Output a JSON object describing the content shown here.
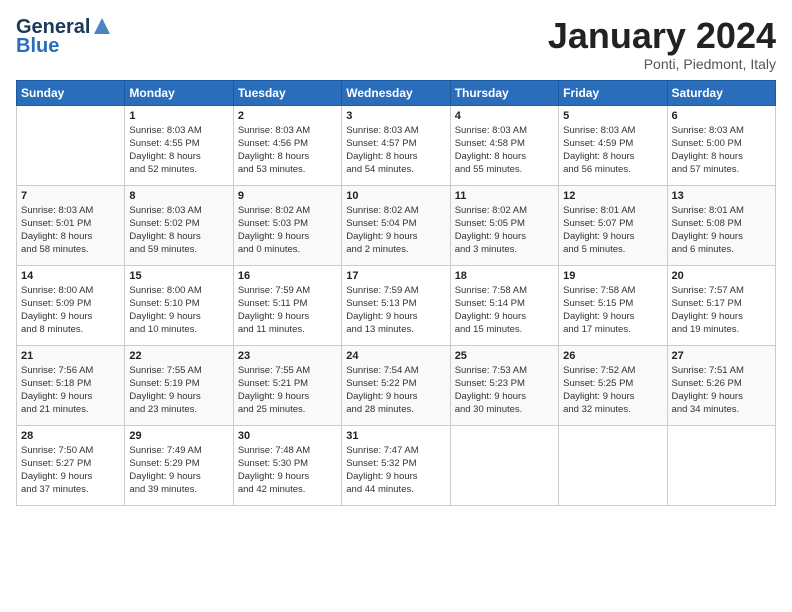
{
  "logo": {
    "line1": "General",
    "line2": "Blue"
  },
  "title": "January 2024",
  "subtitle": "Ponti, Piedmont, Italy",
  "days_header": [
    "Sunday",
    "Monday",
    "Tuesday",
    "Wednesday",
    "Thursday",
    "Friday",
    "Saturday"
  ],
  "weeks": [
    [
      {
        "day": "",
        "info": ""
      },
      {
        "day": "1",
        "info": "Sunrise: 8:03 AM\nSunset: 4:55 PM\nDaylight: 8 hours\nand 52 minutes."
      },
      {
        "day": "2",
        "info": "Sunrise: 8:03 AM\nSunset: 4:56 PM\nDaylight: 8 hours\nand 53 minutes."
      },
      {
        "day": "3",
        "info": "Sunrise: 8:03 AM\nSunset: 4:57 PM\nDaylight: 8 hours\nand 54 minutes."
      },
      {
        "day": "4",
        "info": "Sunrise: 8:03 AM\nSunset: 4:58 PM\nDaylight: 8 hours\nand 55 minutes."
      },
      {
        "day": "5",
        "info": "Sunrise: 8:03 AM\nSunset: 4:59 PM\nDaylight: 8 hours\nand 56 minutes."
      },
      {
        "day": "6",
        "info": "Sunrise: 8:03 AM\nSunset: 5:00 PM\nDaylight: 8 hours\nand 57 minutes."
      }
    ],
    [
      {
        "day": "7",
        "info": "Sunrise: 8:03 AM\nSunset: 5:01 PM\nDaylight: 8 hours\nand 58 minutes."
      },
      {
        "day": "8",
        "info": "Sunrise: 8:03 AM\nSunset: 5:02 PM\nDaylight: 8 hours\nand 59 minutes."
      },
      {
        "day": "9",
        "info": "Sunrise: 8:02 AM\nSunset: 5:03 PM\nDaylight: 9 hours\nand 0 minutes."
      },
      {
        "day": "10",
        "info": "Sunrise: 8:02 AM\nSunset: 5:04 PM\nDaylight: 9 hours\nand 2 minutes."
      },
      {
        "day": "11",
        "info": "Sunrise: 8:02 AM\nSunset: 5:05 PM\nDaylight: 9 hours\nand 3 minutes."
      },
      {
        "day": "12",
        "info": "Sunrise: 8:01 AM\nSunset: 5:07 PM\nDaylight: 9 hours\nand 5 minutes."
      },
      {
        "day": "13",
        "info": "Sunrise: 8:01 AM\nSunset: 5:08 PM\nDaylight: 9 hours\nand 6 minutes."
      }
    ],
    [
      {
        "day": "14",
        "info": "Sunrise: 8:00 AM\nSunset: 5:09 PM\nDaylight: 9 hours\nand 8 minutes."
      },
      {
        "day": "15",
        "info": "Sunrise: 8:00 AM\nSunset: 5:10 PM\nDaylight: 9 hours\nand 10 minutes."
      },
      {
        "day": "16",
        "info": "Sunrise: 7:59 AM\nSunset: 5:11 PM\nDaylight: 9 hours\nand 11 minutes."
      },
      {
        "day": "17",
        "info": "Sunrise: 7:59 AM\nSunset: 5:13 PM\nDaylight: 9 hours\nand 13 minutes."
      },
      {
        "day": "18",
        "info": "Sunrise: 7:58 AM\nSunset: 5:14 PM\nDaylight: 9 hours\nand 15 minutes."
      },
      {
        "day": "19",
        "info": "Sunrise: 7:58 AM\nSunset: 5:15 PM\nDaylight: 9 hours\nand 17 minutes."
      },
      {
        "day": "20",
        "info": "Sunrise: 7:57 AM\nSunset: 5:17 PM\nDaylight: 9 hours\nand 19 minutes."
      }
    ],
    [
      {
        "day": "21",
        "info": "Sunrise: 7:56 AM\nSunset: 5:18 PM\nDaylight: 9 hours\nand 21 minutes."
      },
      {
        "day": "22",
        "info": "Sunrise: 7:55 AM\nSunset: 5:19 PM\nDaylight: 9 hours\nand 23 minutes."
      },
      {
        "day": "23",
        "info": "Sunrise: 7:55 AM\nSunset: 5:21 PM\nDaylight: 9 hours\nand 25 minutes."
      },
      {
        "day": "24",
        "info": "Sunrise: 7:54 AM\nSunset: 5:22 PM\nDaylight: 9 hours\nand 28 minutes."
      },
      {
        "day": "25",
        "info": "Sunrise: 7:53 AM\nSunset: 5:23 PM\nDaylight: 9 hours\nand 30 minutes."
      },
      {
        "day": "26",
        "info": "Sunrise: 7:52 AM\nSunset: 5:25 PM\nDaylight: 9 hours\nand 32 minutes."
      },
      {
        "day": "27",
        "info": "Sunrise: 7:51 AM\nSunset: 5:26 PM\nDaylight: 9 hours\nand 34 minutes."
      }
    ],
    [
      {
        "day": "28",
        "info": "Sunrise: 7:50 AM\nSunset: 5:27 PM\nDaylight: 9 hours\nand 37 minutes."
      },
      {
        "day": "29",
        "info": "Sunrise: 7:49 AM\nSunset: 5:29 PM\nDaylight: 9 hours\nand 39 minutes."
      },
      {
        "day": "30",
        "info": "Sunrise: 7:48 AM\nSunset: 5:30 PM\nDaylight: 9 hours\nand 42 minutes."
      },
      {
        "day": "31",
        "info": "Sunrise: 7:47 AM\nSunset: 5:32 PM\nDaylight: 9 hours\nand 44 minutes."
      },
      {
        "day": "",
        "info": ""
      },
      {
        "day": "",
        "info": ""
      },
      {
        "day": "",
        "info": ""
      }
    ]
  ]
}
